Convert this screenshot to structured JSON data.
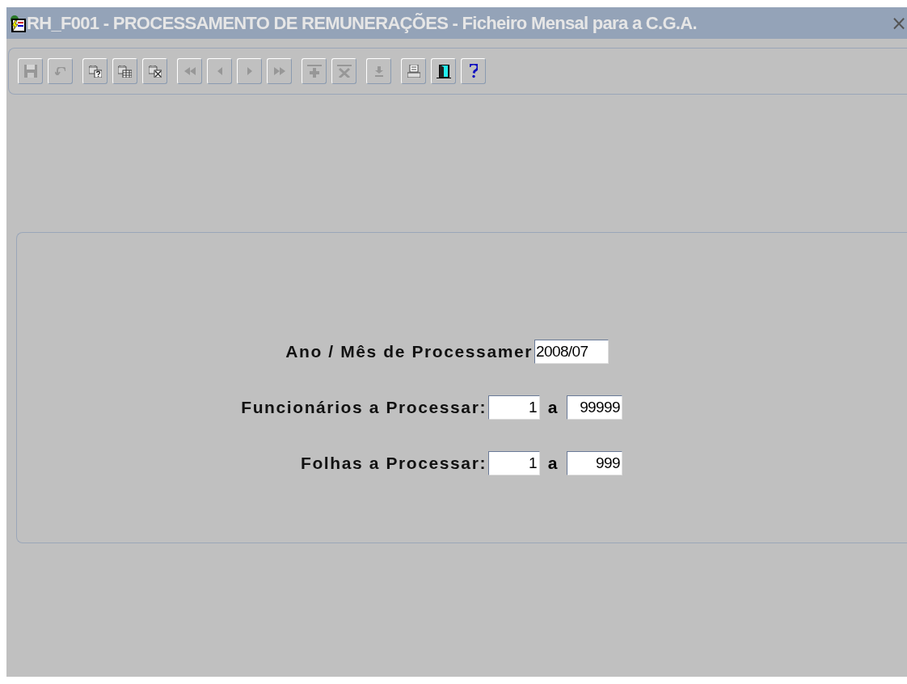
{
  "window": {
    "title": "RH_F001 - PROCESSAMENTO DE REMUNERAÇÕES - Ficheiro Mensal para a C.G.A.",
    "close": "×"
  },
  "toolbar": [
    {
      "kind": "save",
      "disabled": true
    },
    {
      "kind": "undo",
      "disabled": true
    },
    {
      "kind": "query",
      "disabled": false
    },
    {
      "kind": "execute-query",
      "disabled": false
    },
    {
      "kind": "cancel-query",
      "disabled": false
    },
    {
      "kind": "first",
      "disabled": true
    },
    {
      "kind": "previous",
      "disabled": true
    },
    {
      "kind": "next",
      "disabled": true
    },
    {
      "kind": "last",
      "disabled": true
    },
    {
      "kind": "insert",
      "disabled": true
    },
    {
      "kind": "delete",
      "disabled": true
    },
    {
      "kind": "download",
      "disabled": true
    },
    {
      "kind": "print",
      "disabled": false
    },
    {
      "kind": "exit",
      "disabled": false
    },
    {
      "kind": "help",
      "disabled": false
    }
  ],
  "form": {
    "rows": [
      {
        "kind": "single",
        "label": "Ano / Mês de Processamer",
        "value": "2008/07"
      },
      {
        "kind": "range",
        "label": "Funcionários a Processar:",
        "from": "1",
        "separator": "a",
        "to": "99999"
      },
      {
        "kind": "range",
        "label": "Folhas a Processar:",
        "from": "1",
        "separator": "a",
        "to": "999"
      }
    ]
  }
}
